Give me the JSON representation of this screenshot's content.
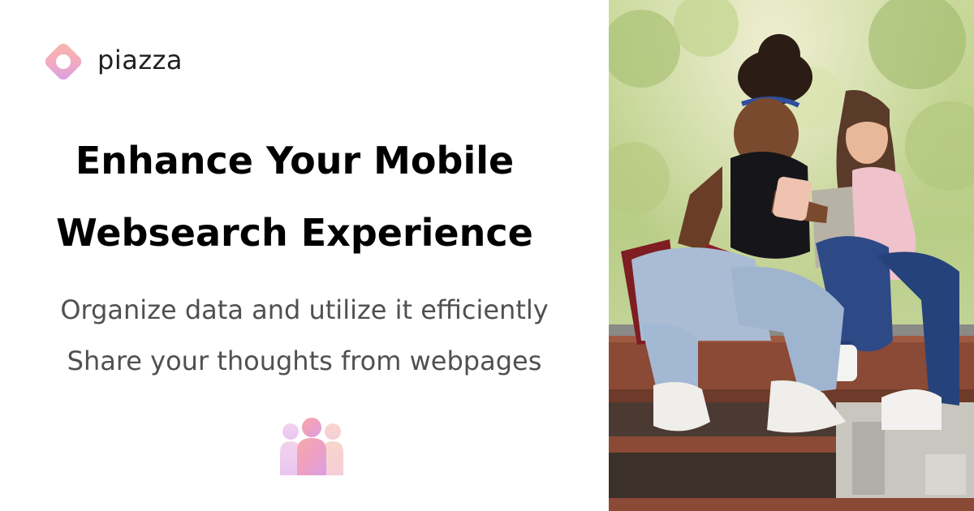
{
  "brand": {
    "name": "piazza",
    "logo_icon": "piazza-logo-icon",
    "gradient_colors": [
      "#f6b4b4",
      "#d9a0e6"
    ]
  },
  "headline": {
    "line1": "Enhance Your Mobile",
    "line2": "Websearch Experience"
  },
  "features": [
    "Organize data and utilize it efficiently",
    "Share your thoughts from webpages"
  ],
  "decor": {
    "people_icon": "people-group-icon"
  },
  "photo": {
    "subject": "two-girls-looking-at-phone-photo"
  }
}
